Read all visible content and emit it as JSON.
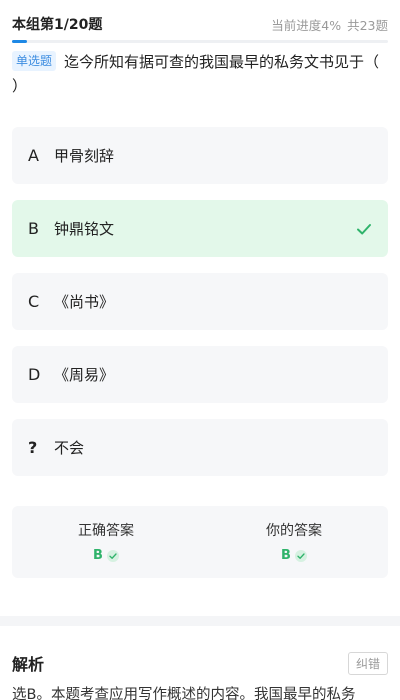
{
  "header": {
    "group_progress": "本组第1/20题",
    "current_progress": "当前进度4%",
    "total": "共23题",
    "progress_fraction": 0.04
  },
  "question": {
    "type_badge": "单选题",
    "text": "迄今所知有据可查的我国最早的私务文书见于（ ）"
  },
  "options": [
    {
      "letter": "A",
      "text": "甲骨刻辞",
      "state": "normal"
    },
    {
      "letter": "B",
      "text": "钟鼎铭文",
      "state": "correct"
    },
    {
      "letter": "C",
      "text": "《尚书》",
      "state": "normal"
    },
    {
      "letter": "D",
      "text": "《周易》",
      "state": "normal"
    },
    {
      "letter": "?",
      "text": "不会",
      "state": "normal"
    }
  ],
  "answers": {
    "correct_label": "正确答案",
    "correct_value": "B",
    "yours_label": "你的答案",
    "yours_value": "B"
  },
  "analysis": {
    "title": "解析",
    "report_label": "纠错",
    "text": "选B。本题考查应用写作概述的内容。我国最早的私务"
  },
  "colors": {
    "accent": "#1e88e5",
    "correct_bg": "#e3f8ea",
    "correct_fg": "#2fb36b",
    "badge_bg": "#e8f3ff"
  }
}
